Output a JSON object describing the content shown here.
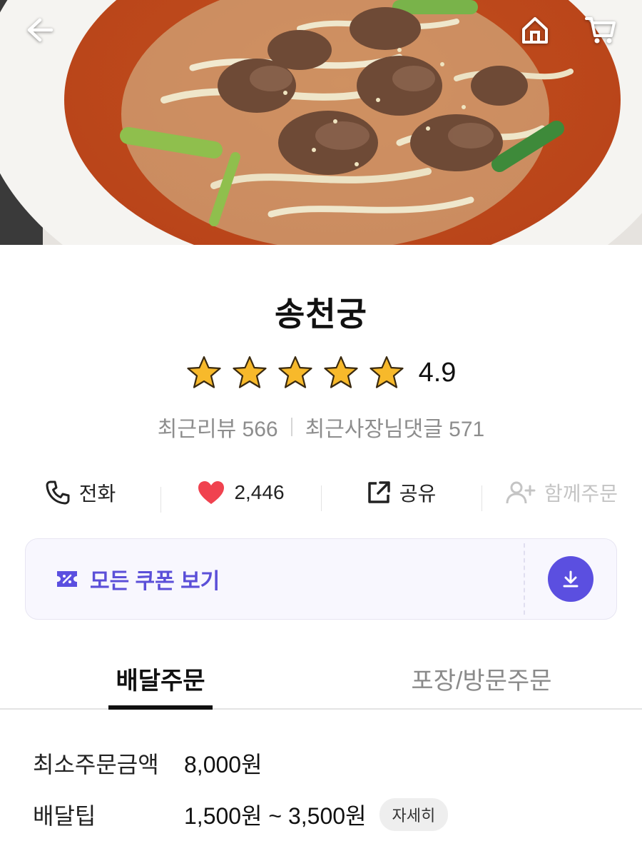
{
  "store": {
    "name": "송천궁",
    "rating_value": "4.9",
    "rating": 4.9,
    "reviews": "최근리뷰 566",
    "owner_replies": "최근사장님댓글 571"
  },
  "actions": {
    "call": "전화",
    "likes": "2,446",
    "share": "공유",
    "group_order": "함께주문"
  },
  "coupon": {
    "label": "모든 쿠폰 보기"
  },
  "tabs": [
    {
      "label": "배달주문",
      "active": true
    },
    {
      "label": "포장/방문주문",
      "active": false
    }
  ],
  "info": {
    "min_order_label": "최소주문금액",
    "min_order_value": "8,000원",
    "delivery_tip_label": "배달팁",
    "delivery_tip_value": "1,500원 ~ 3,500원",
    "detail_button": "자세히"
  },
  "colors": {
    "accent": "#5b4fe0",
    "heart": "#f0424f",
    "star": "#f7b92b"
  },
  "icons": [
    "back-arrow-icon",
    "home-icon",
    "cart-icon",
    "star-icon",
    "phone-icon",
    "heart-icon",
    "share-icon",
    "add-person-icon",
    "coupon-icon",
    "download-icon"
  ]
}
